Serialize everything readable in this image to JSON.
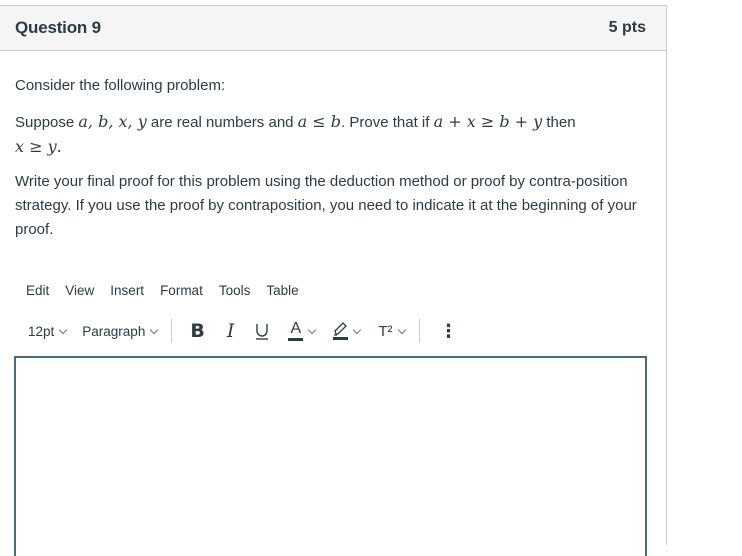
{
  "question": {
    "title": "Question 9",
    "points": "5 pts"
  },
  "body": {
    "intro": "Consider the following problem:",
    "problem": {
      "prefix": "Suppose ",
      "vars": "a, b, x, y",
      "mid": " are real numbers and ",
      "cond_a": "a",
      "cond_op": " ≤ ",
      "cond_b": "b",
      "after_cond": ". Prove that if ",
      "lhs": "a + x",
      "ge": " ≥ ",
      "rhs": "b + y",
      "then": " then",
      "concl_x": "x",
      "concl_op": " ≥ ",
      "concl_y": "y",
      "end": "."
    },
    "instructions": "Write your  final proof for this problem using the deduction method or proof by contra-position strategy. If you use the proof by contraposition, you need to indicate it at the beginning of your proof."
  },
  "editor": {
    "menu": [
      "Edit",
      "View",
      "Insert",
      "Format",
      "Tools",
      "Table"
    ],
    "font_size": "12pt",
    "block_format": "Paragraph",
    "buttons": {
      "bold": "B",
      "italic": "I",
      "underline": "U",
      "text_color": "A",
      "superscript": "T²",
      "more": "⋮"
    },
    "content": ""
  },
  "colors": {
    "text": "#2d3b45",
    "header_bg": "#f5f5f5",
    "border": "#c7cdd1",
    "editor_border": "#4a6b7c"
  }
}
